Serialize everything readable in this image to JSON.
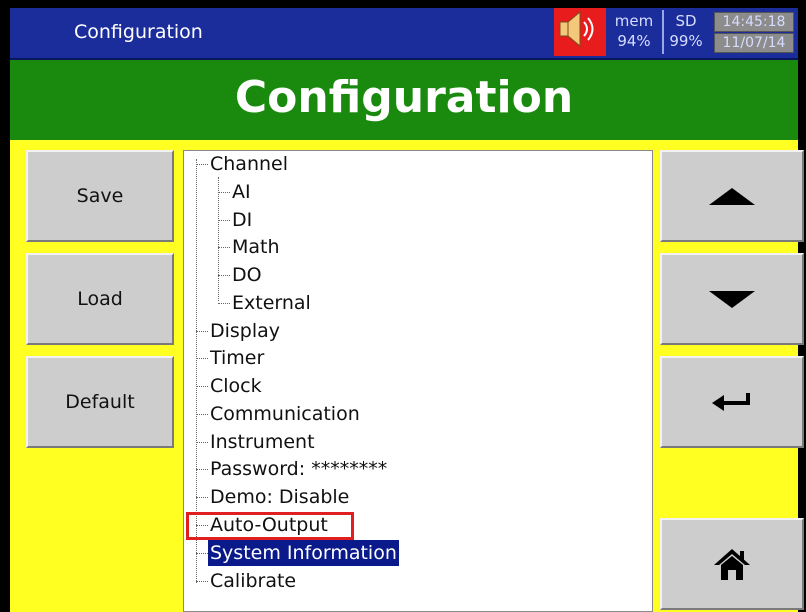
{
  "window": {
    "title": "Configuration"
  },
  "status": {
    "mem_label": "mem",
    "mem_value": "94%",
    "sd_label": "SD",
    "sd_value": "99%",
    "time": "14:45:18",
    "date": "11/07/14",
    "speaker_icon": "speaker-icon",
    "speaker_color": "#e81c1c"
  },
  "header": {
    "title": "Configuration",
    "color": "#1a8a0f"
  },
  "buttons": {
    "save": "Save",
    "load": "Load",
    "default": "Default",
    "up_icon": "arrow-up-icon",
    "down_icon": "arrow-down-icon",
    "enter_icon": "enter-icon",
    "home_icon": "home-icon"
  },
  "tree": {
    "items": [
      {
        "label": "Channel"
      },
      {
        "label": "AI"
      },
      {
        "label": "DI"
      },
      {
        "label": "Math"
      },
      {
        "label": "DO"
      },
      {
        "label": "External"
      },
      {
        "label": "Display"
      },
      {
        "label": "Timer"
      },
      {
        "label": "Clock"
      },
      {
        "label": "Communication"
      },
      {
        "label": "Instrument"
      },
      {
        "label": "Password: ********"
      },
      {
        "label": "Demo: Disable"
      },
      {
        "label": "Auto-Output"
      },
      {
        "label": "System Information",
        "selected": true
      },
      {
        "label": "Calibrate"
      }
    ]
  },
  "colors": {
    "top_bar": "#1b2d9b",
    "body_background": "#ffff22",
    "selection": "#0a1a8a",
    "highlight_border": "#e02020"
  }
}
